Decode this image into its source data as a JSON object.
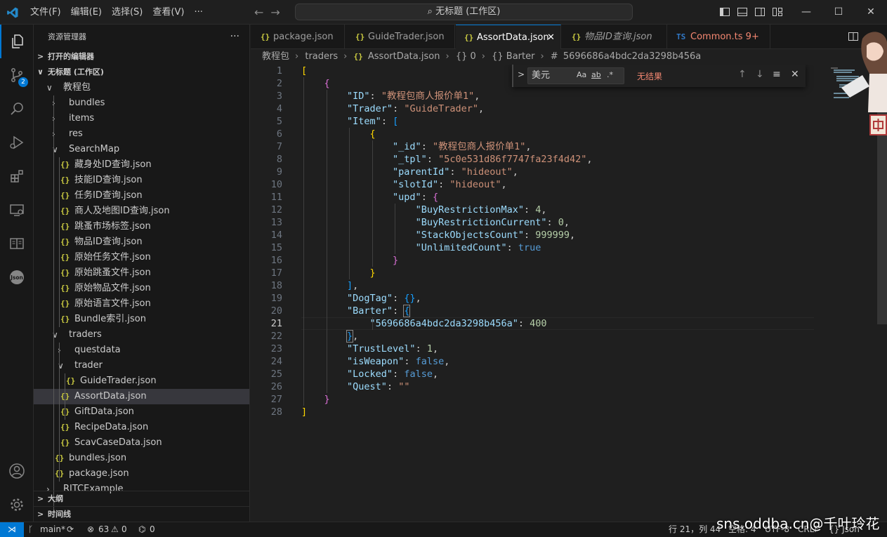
{
  "titlebar": {
    "menus": [
      "文件(F)",
      "编辑(E)",
      "选择(S)",
      "查看(V)",
      "···"
    ],
    "search": "无标题 (工作区)",
    "window_controls": {
      "minimize": "—",
      "maximize": "☐",
      "close": "✕"
    }
  },
  "activity": {
    "scm_badge": "2",
    "json_label": "Json"
  },
  "sidebar": {
    "title": "资源管理器",
    "more": "···",
    "open_editors": "打开的编辑器",
    "workspace": "无标题 (工作区)",
    "tree": [
      {
        "label": "教程包",
        "kind": "folder-open"
      },
      {
        "label": "bundles",
        "kind": "folder"
      },
      {
        "label": "items",
        "kind": "folder"
      },
      {
        "label": "res",
        "kind": "folder"
      },
      {
        "label": "SearchMap",
        "kind": "folder-open"
      },
      {
        "label": "藏身处ID查询.json",
        "kind": "file"
      },
      {
        "label": "技能ID查询.json",
        "kind": "file"
      },
      {
        "label": "任务ID查询.json",
        "kind": "file"
      },
      {
        "label": "商人及地图ID查询.json",
        "kind": "file"
      },
      {
        "label": "跳蚤市场标签.json",
        "kind": "file"
      },
      {
        "label": "物品ID查询.json",
        "kind": "file"
      },
      {
        "label": "原始任务文件.json",
        "kind": "file"
      },
      {
        "label": "原始跳蚤文件.json",
        "kind": "file"
      },
      {
        "label": "原始物品文件.json",
        "kind": "file"
      },
      {
        "label": "原始语言文件.json",
        "kind": "file"
      },
      {
        "label": "Bundle索引.json",
        "kind": "file"
      },
      {
        "label": "traders",
        "kind": "folder-open"
      },
      {
        "label": "questdata",
        "kind": "folder"
      },
      {
        "label": "trader",
        "kind": "folder-open"
      },
      {
        "label": "GuideTrader.json",
        "kind": "file"
      },
      {
        "label": "AssortData.json",
        "kind": "file"
      },
      {
        "label": "GiftData.json",
        "kind": "file"
      },
      {
        "label": "RecipeData.json",
        "kind": "file"
      },
      {
        "label": "ScavCaseData.json",
        "kind": "file"
      },
      {
        "label": "bundles.json",
        "kind": "file"
      },
      {
        "label": "package.json",
        "kind": "file"
      },
      {
        "label": "RITCExample",
        "kind": "folder"
      }
    ],
    "outline": "大纲",
    "timeline": "时间线"
  },
  "tabs": [
    {
      "label": "package.json",
      "icon": "{}"
    },
    {
      "label": "GuideTrader.json",
      "icon": "{}"
    },
    {
      "label": "AssortData.json",
      "icon": "{}",
      "close": "✕"
    },
    {
      "label": "物品ID查询.json",
      "icon": "{}"
    },
    {
      "label": "Common.ts 9+",
      "icon": "TS"
    }
  ],
  "breadcrumb": [
    "教程包",
    "traders",
    "AssortData.json",
    "{} 0",
    "{} Barter",
    "5696686a4bdc2da3298b456a"
  ],
  "find": {
    "value": "美元",
    "opt_case": "Aa",
    "opt_word": "ab",
    "opt_regex": ".*",
    "result": "无结果",
    "prev": "↑",
    "next": "↓",
    "sel": "≡",
    "close": "✕"
  },
  "editor": {
    "line_numbers": [
      "1",
      "2",
      "3",
      "4",
      "5",
      "6",
      "7",
      "8",
      "9",
      "10",
      "11",
      "12",
      "13",
      "14",
      "15",
      "16",
      "17",
      "18",
      "19",
      "20",
      "21",
      "22",
      "23",
      "24",
      "25",
      "26",
      "27",
      "28"
    ],
    "current_line": "21",
    "code": {
      "id_key": "\"ID\"",
      "id_val": "\"教程包商人报价单1\"",
      "trader_key": "\"Trader\"",
      "trader_val": "\"GuideTrader\"",
      "item_key": "\"Item\"",
      "_id_key": "\"_id\"",
      "_id_val": "\"教程包商人报价单1\"",
      "tpl_key": "\"_tpl\"",
      "tpl_val": "\"5c0e531d86f7747fa23f4d42\"",
      "parent_key": "\"parentId\"",
      "parent_val": "\"hideout\"",
      "slot_key": "\"slotId\"",
      "slot_val": "\"hideout\"",
      "upd_key": "\"upd\"",
      "brm_key": "\"BuyRestrictionMax\"",
      "brm_val": "4",
      "brc_key": "\"BuyRestrictionCurrent\"",
      "brc_val": "0",
      "soc_key": "\"StackObjectsCount\"",
      "soc_val": "999999",
      "uc_key": "\"UnlimitedCount\"",
      "uc_val": "true",
      "dog_key": "\"DogTag\"",
      "barter_key": "\"Barter\"",
      "hash_key": "\"5696686a4bdc2da3298b456a\"",
      "hash_val": "400",
      "trust_key": "\"TrustLevel\"",
      "trust_val": "1",
      "weapon_key": "\"isWeapon\"",
      "weapon_val": "false",
      "locked_key": "\"Locked\"",
      "locked_val": "false",
      "quest_key": "\"Quest\"",
      "quest_val": "\"\""
    }
  },
  "statusbar": {
    "remote": "⋊",
    "branch": "main*",
    "sync": "⟳",
    "errors": "63",
    "warnings": "0",
    "ports": "0",
    "position": "行 21，列 44",
    "spaces": "空格: 4",
    "encoding": "UTF-8",
    "eol": "CRLF",
    "language": "{} Json"
  },
  "watermark": "sns.oddba.cn@千叶玲花",
  "colors": {
    "accent": "#0078d4",
    "json_icon": "#cbcb41",
    "error_text": "#f48771"
  }
}
